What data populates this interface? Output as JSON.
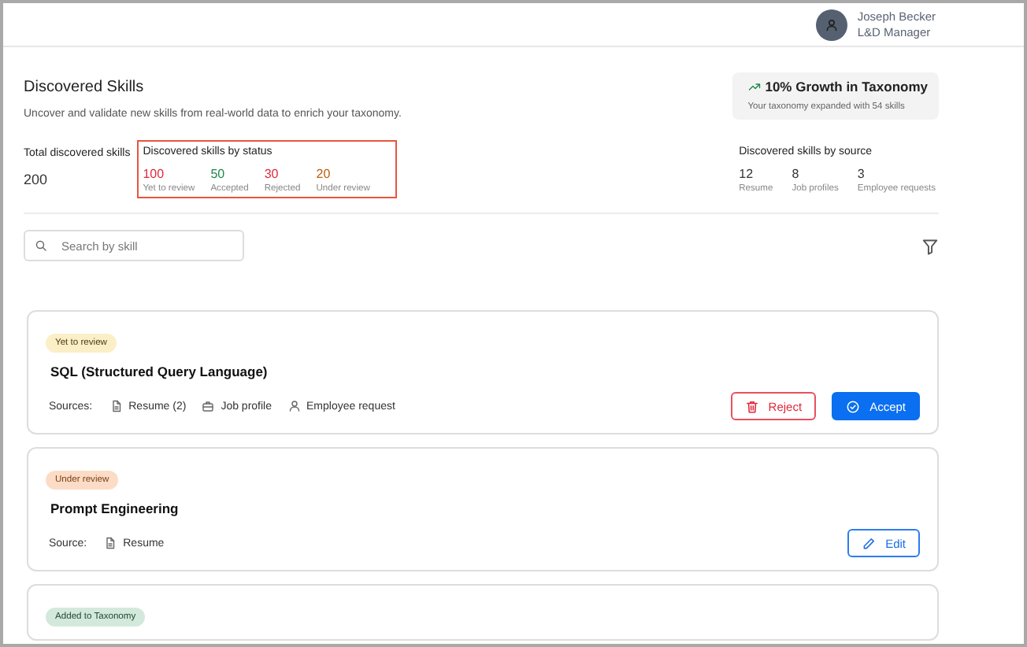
{
  "user": {
    "name": "Joseph Becker",
    "role": "L&D Manager"
  },
  "page": {
    "title": "Discovered Skills",
    "subtitle": "Uncover and validate new skills from real-world data to enrich your taxonomy."
  },
  "growth": {
    "title": "10% Growth in Taxonomy",
    "note": "Your taxonomy expanded with 54 skills"
  },
  "total": {
    "label": "Total discovered skills",
    "value": "200"
  },
  "by_status": {
    "label": "Discovered skills by status",
    "items": [
      {
        "value": "100",
        "label": "Yet to review",
        "color": "#e0283c"
      },
      {
        "value": "50",
        "label": "Accepted",
        "color": "#1e8a4c"
      },
      {
        "value": "30",
        "label": "Rejected",
        "color": "#e0283c"
      },
      {
        "value": "20",
        "label": "Under review",
        "color": "#b8620e"
      }
    ]
  },
  "by_source": {
    "label": "Discovered skills by source",
    "items": [
      {
        "value": "12",
        "label": "Resume"
      },
      {
        "value": "8",
        "label": "Job profiles"
      },
      {
        "value": "3",
        "label": "Employee requests"
      }
    ]
  },
  "search": {
    "placeholder": "Search by skill"
  },
  "cards": [
    {
      "status": {
        "label": "Yet to review",
        "kind": "pending"
      },
      "title": "SQL (Structured Query Language)",
      "sources_label": "Sources:",
      "sources": [
        {
          "kind": "document",
          "label": "Resume (2)"
        },
        {
          "kind": "briefcase",
          "label": "Job profile"
        },
        {
          "kind": "person",
          "label": "Employee request"
        }
      ],
      "actions": [
        {
          "kind": "reject",
          "label": "Reject"
        },
        {
          "kind": "accept",
          "label": "Accept"
        }
      ]
    },
    {
      "status": {
        "label": "Under review",
        "kind": "review"
      },
      "title": "Prompt Engineering",
      "sources_label": "Source:",
      "sources": [
        {
          "kind": "document",
          "label": "Resume"
        }
      ],
      "actions": [
        {
          "kind": "edit",
          "label": "Edit"
        }
      ]
    },
    {
      "status": {
        "label": "Added to Taxonomy",
        "kind": "added"
      }
    }
  ]
}
